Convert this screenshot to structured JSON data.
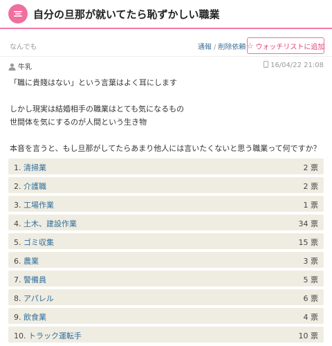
{
  "header": {
    "title": "自分の旦那が就いてたら恥ずかしい職業",
    "icon": "speech-bubble-icon",
    "accent": "#ef6f9f"
  },
  "meta": {
    "category": "なんでも",
    "report_label": "通報",
    "separator": "/",
    "delete_request_label": "削除依頼",
    "watchlist_label": "ウォッチリストに追加",
    "watchlist_icon": "star-icon"
  },
  "post": {
    "author": "牛乳",
    "author_icon": "user-icon",
    "time_icon": "mobile-icon",
    "timestamp": "16/04/22 21:08",
    "lines": [
      "「職に貴賤はない」という言葉はよく耳にします",
      "",
      "しかし現実は結婚相手の職業はとても気になるもの",
      "世間体を気にするのが人間という生き物",
      "",
      "本音を言うと、もし旦那がしてたらあまり他人には言いたくないと思う職業って何ですか？"
    ]
  },
  "poll": {
    "vote_unit": "票",
    "bar_color": "#efece2",
    "options": [
      {
        "rank": "1.",
        "label": "清掃業",
        "votes": "2"
      },
      {
        "rank": "2.",
        "label": "介護職",
        "votes": "2"
      },
      {
        "rank": "3.",
        "label": "工場作業",
        "votes": "1"
      },
      {
        "rank": "4.",
        "label": "土木、建設作業",
        "votes": "34"
      },
      {
        "rank": "5.",
        "label": "ゴミ収集",
        "votes": "15"
      },
      {
        "rank": "6.",
        "label": "農業",
        "votes": "3"
      },
      {
        "rank": "7.",
        "label": "警備員",
        "votes": "5"
      },
      {
        "rank": "8.",
        "label": "アパレル",
        "votes": "6"
      },
      {
        "rank": "9.",
        "label": "飲食業",
        "votes": "4"
      },
      {
        "rank": "10.",
        "label": "トラック運転手",
        "votes": "10"
      }
    ]
  }
}
